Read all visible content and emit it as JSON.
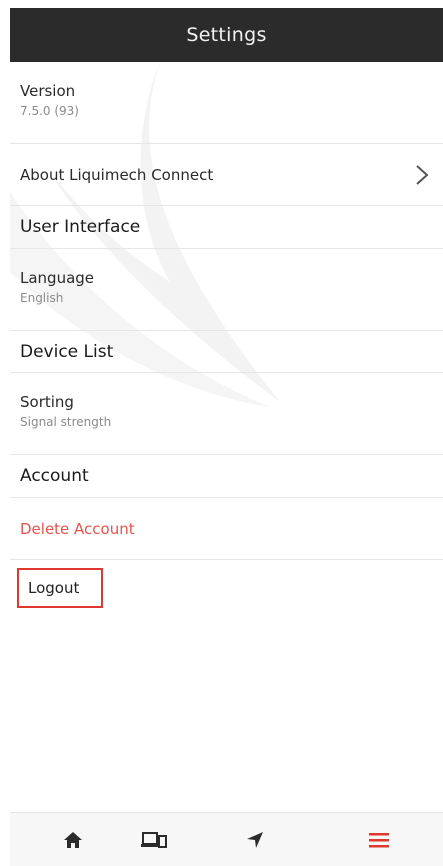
{
  "header": {
    "title": "Settings"
  },
  "version": {
    "label": "Version",
    "value": "7.5.0 (93)"
  },
  "about": {
    "label": "About Liquimech Connect"
  },
  "sections": {
    "user_interface": "User Interface",
    "device_list": "Device List",
    "account": "Account"
  },
  "language": {
    "label": "Language",
    "value": "English"
  },
  "sorting": {
    "label": "Sorting",
    "value": "Signal strength"
  },
  "account": {
    "delete_label": "Delete Account",
    "logout_label": "Logout"
  },
  "tabs": [
    {
      "icon": "home-icon",
      "active": false
    },
    {
      "icon": "devices-icon",
      "active": false
    },
    {
      "icon": "navigation-arrow-icon",
      "active": false
    },
    {
      "icon": "menu-icon",
      "active": true
    }
  ],
  "colors": {
    "header_bg": "#2b2b2b",
    "danger": "#e9534c",
    "active_tab": "#e0382f",
    "highlight_box": "#e0382f",
    "icon": "#2b2b2b"
  }
}
